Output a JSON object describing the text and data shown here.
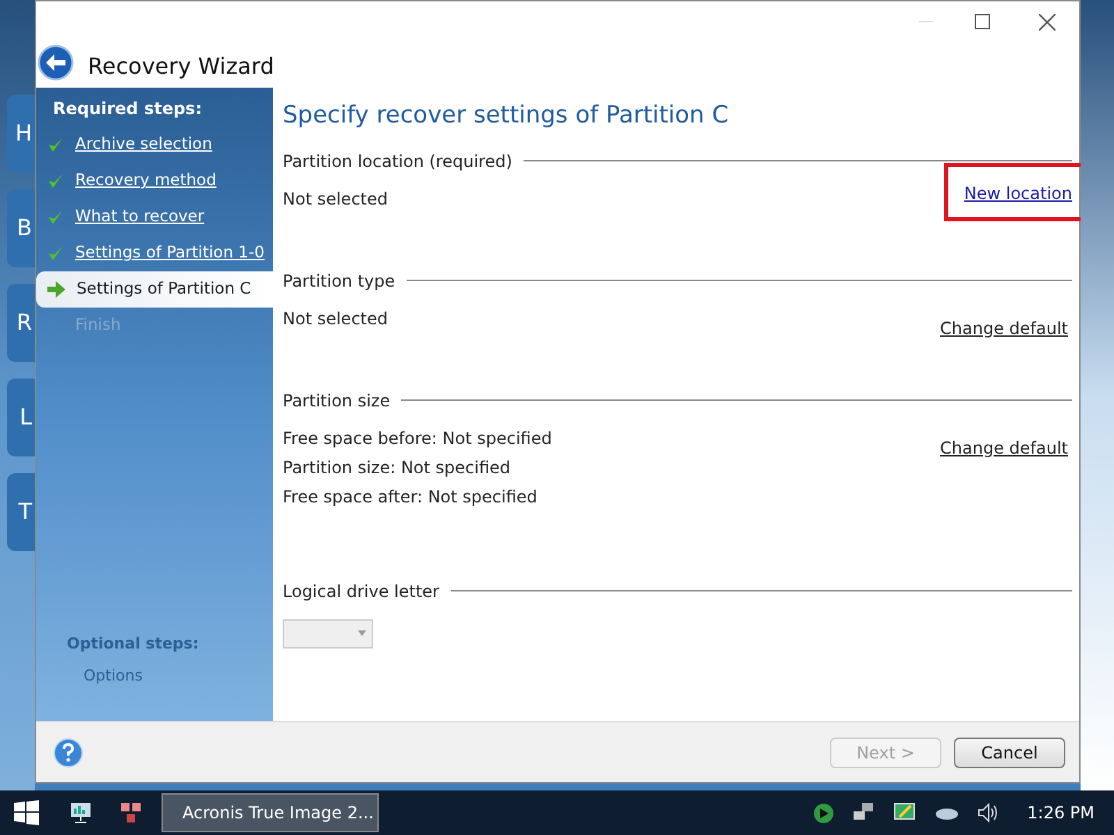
{
  "background_app": {
    "tile_letters": [
      "H",
      "B",
      "R",
      "L",
      "T"
    ]
  },
  "window": {
    "title": "Recovery Wizard"
  },
  "sidebar": {
    "required_heading": "Required steps:",
    "steps": [
      {
        "label": "Archive selection",
        "kind": "done"
      },
      {
        "label": "Recovery method",
        "kind": "done"
      },
      {
        "label": "What to recover",
        "kind": "done"
      },
      {
        "label": "Settings of Partition 1-0",
        "kind": "done"
      },
      {
        "label": "Settings of Partition C",
        "kind": "current"
      },
      {
        "label": "Finish",
        "kind": "pending"
      }
    ],
    "optional_heading": "Optional steps:",
    "optional_steps": [
      {
        "label": "Options"
      }
    ]
  },
  "content": {
    "heading": "Specify recover settings of Partition C",
    "sections": [
      {
        "title": "Partition location (required)",
        "lines": [
          "Not selected"
        ],
        "link": "New location",
        "highlighted": true
      },
      {
        "title": "Partition type",
        "lines": [
          "Not selected"
        ],
        "link": "Change default",
        "highlighted": false
      },
      {
        "title": "Partition size",
        "lines": [
          "Free space before: Not specified",
          "Partition size: Not specified",
          "Free space after: Not specified"
        ],
        "link": "Change default",
        "highlighted": false
      },
      {
        "title": "Logical drive letter",
        "dropdown": {
          "disabled": true
        }
      }
    ]
  },
  "footer": {
    "buttons": [
      {
        "label": "Next >",
        "disabled": true
      },
      {
        "label": "Cancel",
        "disabled": false
      }
    ]
  },
  "taskbar": {
    "app_label": "Acronis True Image 2...",
    "clock": "1:26 PM"
  }
}
